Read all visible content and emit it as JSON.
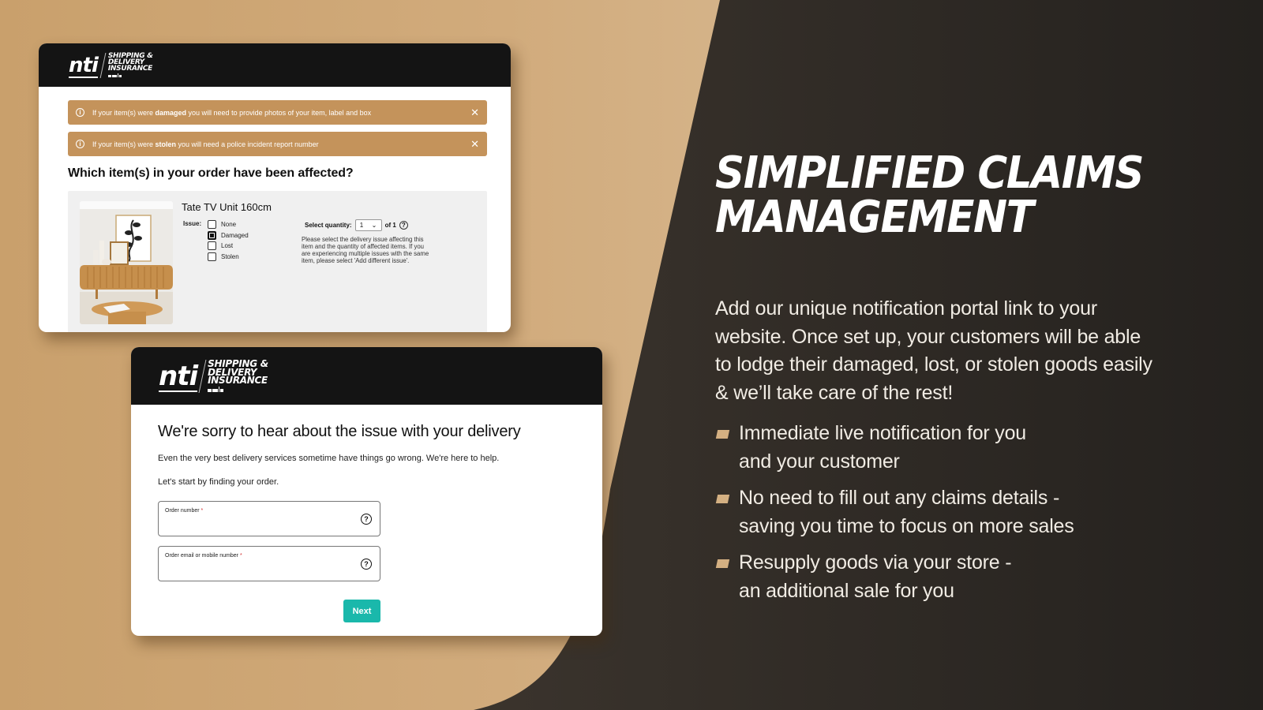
{
  "colors": {
    "beige_bg": "#d1ab7c",
    "dark_bg": "#2d2924",
    "alert_bg": "#c4935b",
    "header_bg": "#141414",
    "accent_teal": "#1ab8ab",
    "bullet_color": "#d4b082"
  },
  "brand": {
    "logo_mark": "nti",
    "logo_line1": "SHIPPING &",
    "logo_line2": "DELIVERY",
    "logo_line3": "INSURANCE"
  },
  "claim_screen": {
    "alerts": [
      {
        "prefix": "If your item(s) were ",
        "bold": "damaged",
        "suffix": " you will need to provide photos of your item, label and box",
        "icon": "info-icon",
        "close_icon": "close-icon"
      },
      {
        "prefix": "If your item(s) were ",
        "bold": "stolen",
        "suffix": " you will need a police incident report number",
        "icon": "info-icon",
        "close_icon": "close-icon"
      }
    ],
    "question": "Which item(s) in your order have been affected?",
    "item": {
      "title": "Tate TV Unit 160cm",
      "issue_label": "Issue:",
      "issue_options": [
        {
          "label": "None",
          "checked": false
        },
        {
          "label": "Damaged",
          "checked": true
        },
        {
          "label": "Lost",
          "checked": false
        },
        {
          "label": "Stolen",
          "checked": false
        }
      ],
      "quantity_label": "Select quantity:",
      "quantity_value": "1",
      "quantity_of": "of 1",
      "help_text": "Please select the delivery issue affecting this item and the quantity of affected items. If you are experiencing multiple issues with the same item, please select 'Add different issue'."
    }
  },
  "lookup_screen": {
    "title": "We're sorry to hear about the issue with your delivery",
    "subtitle": "Even the very best delivery services sometime have things go wrong. We're here to help.",
    "prompt": "Let's start by finding your order.",
    "fields": [
      {
        "label": "Order number",
        "required_mark": "*",
        "value": ""
      },
      {
        "label": "Order email or mobile number",
        "required_mark": "*",
        "value": ""
      }
    ],
    "next_label": "Next"
  },
  "marketing": {
    "headline_line1": "SIMPLIFIED CLAIMS",
    "headline_line2": "MANAGEMENT",
    "intro": "Add our unique notification portal link to your website. Once set up, your customers will be able to lodge their damaged, lost, or stolen goods easily & we’ll take care of the rest!",
    "bullets": [
      {
        "line1": "Immediate live notification for you",
        "line2": "and your customer"
      },
      {
        "line1": "No need to fill out any claims details -",
        "line2": "saving you time to focus on more sales"
      },
      {
        "line1": "Resupply goods via your store -",
        "line2": "an additional sale for you"
      }
    ]
  }
}
